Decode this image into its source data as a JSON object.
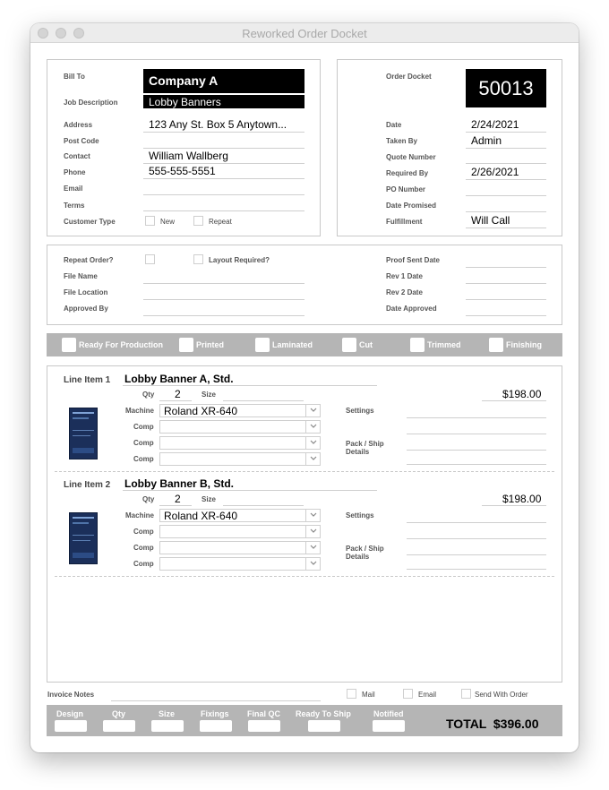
{
  "window": {
    "title": "Reworked Order Docket"
  },
  "customer": {
    "bill_to_label": "Bill To",
    "bill_to": "Company A",
    "job_description_label": "Job Description",
    "job_description": "Lobby Banners",
    "address_label": "Address",
    "address": "123 Any St. Box 5 Anytown...",
    "post_code_label": "Post Code",
    "post_code": "",
    "contact_label": "Contact",
    "contact": "William Wallberg",
    "phone_label": "Phone",
    "phone": "555-555-5551",
    "email_label": "Email",
    "email": "",
    "terms_label": "Terms",
    "terms": "",
    "customer_type_label": "Customer Type",
    "type_new_label": "New",
    "type_repeat_label": "Repeat"
  },
  "docket": {
    "order_docket_label": "Order Docket",
    "order_docket": "50013",
    "date_label": "Date",
    "date": "2/24/2021",
    "taken_by_label": "Taken By",
    "taken_by": "Admin",
    "quote_number_label": "Quote Number",
    "quote_number": "",
    "required_by_label": "Required By",
    "required_by": "2/26/2021",
    "po_number_label": "PO Number",
    "po_number": "",
    "date_promised_label": "Date Promised",
    "date_promised": "",
    "fulfillment_label": "Fulfillment",
    "fulfillment": "Will Call"
  },
  "proof": {
    "repeat_order_label": "Repeat Order?",
    "layout_required_label": "Layout Required?",
    "file_name_label": "File Name",
    "file_location_label": "File Location",
    "approved_by_label": "Approved By",
    "proof_sent_date_label": "Proof Sent Date",
    "rev1_date_label": "Rev 1 Date",
    "rev2_date_label": "Rev 2 Date",
    "date_approved_label": "Date Approved"
  },
  "status": {
    "ready_for_production": "Ready For Production",
    "printed": "Printed",
    "laminated": "Laminated",
    "cut": "Cut",
    "trimmed": "Trimmed",
    "finishing": "Finishing"
  },
  "line_items": [
    {
      "label": "Line Item 1",
      "name": "Lobby Banner A, Std.",
      "qty_label": "Qty",
      "qty": "2",
      "size_label": "Size",
      "price": "$198.00",
      "machine_label": "Machine",
      "machine": "Roland XR-640",
      "comp_label": "Comp",
      "settings_label": "Settings",
      "pack_ship_label_1": "Pack / Ship",
      "pack_ship_label_2": "Details"
    },
    {
      "label": "Line Item 2",
      "name": "Lobby Banner B, Std.",
      "qty_label": "Qty",
      "qty": "2",
      "size_label": "Size",
      "price": "$198.00",
      "machine_label": "Machine",
      "machine": "Roland XR-640",
      "comp_label": "Comp",
      "settings_label": "Settings",
      "pack_ship_label_1": "Pack / Ship",
      "pack_ship_label_2": "Details"
    }
  ],
  "invoice": {
    "notes_label": "Invoice Notes",
    "mail_label": "Mail",
    "email_label": "Email",
    "send_with_order_label": "Send With Order"
  },
  "footer": {
    "design": "Design",
    "qty": "Qty",
    "size": "Size",
    "fixings": "Fixings",
    "final_qc": "Final QC",
    "ready_to_ship": "Ready To Ship",
    "notified": "Notified",
    "total": "TOTAL  $396.00"
  },
  "icons": {
    "dropdown": "chevron-down-icon",
    "thumbnail": "banner-thumbnail"
  }
}
